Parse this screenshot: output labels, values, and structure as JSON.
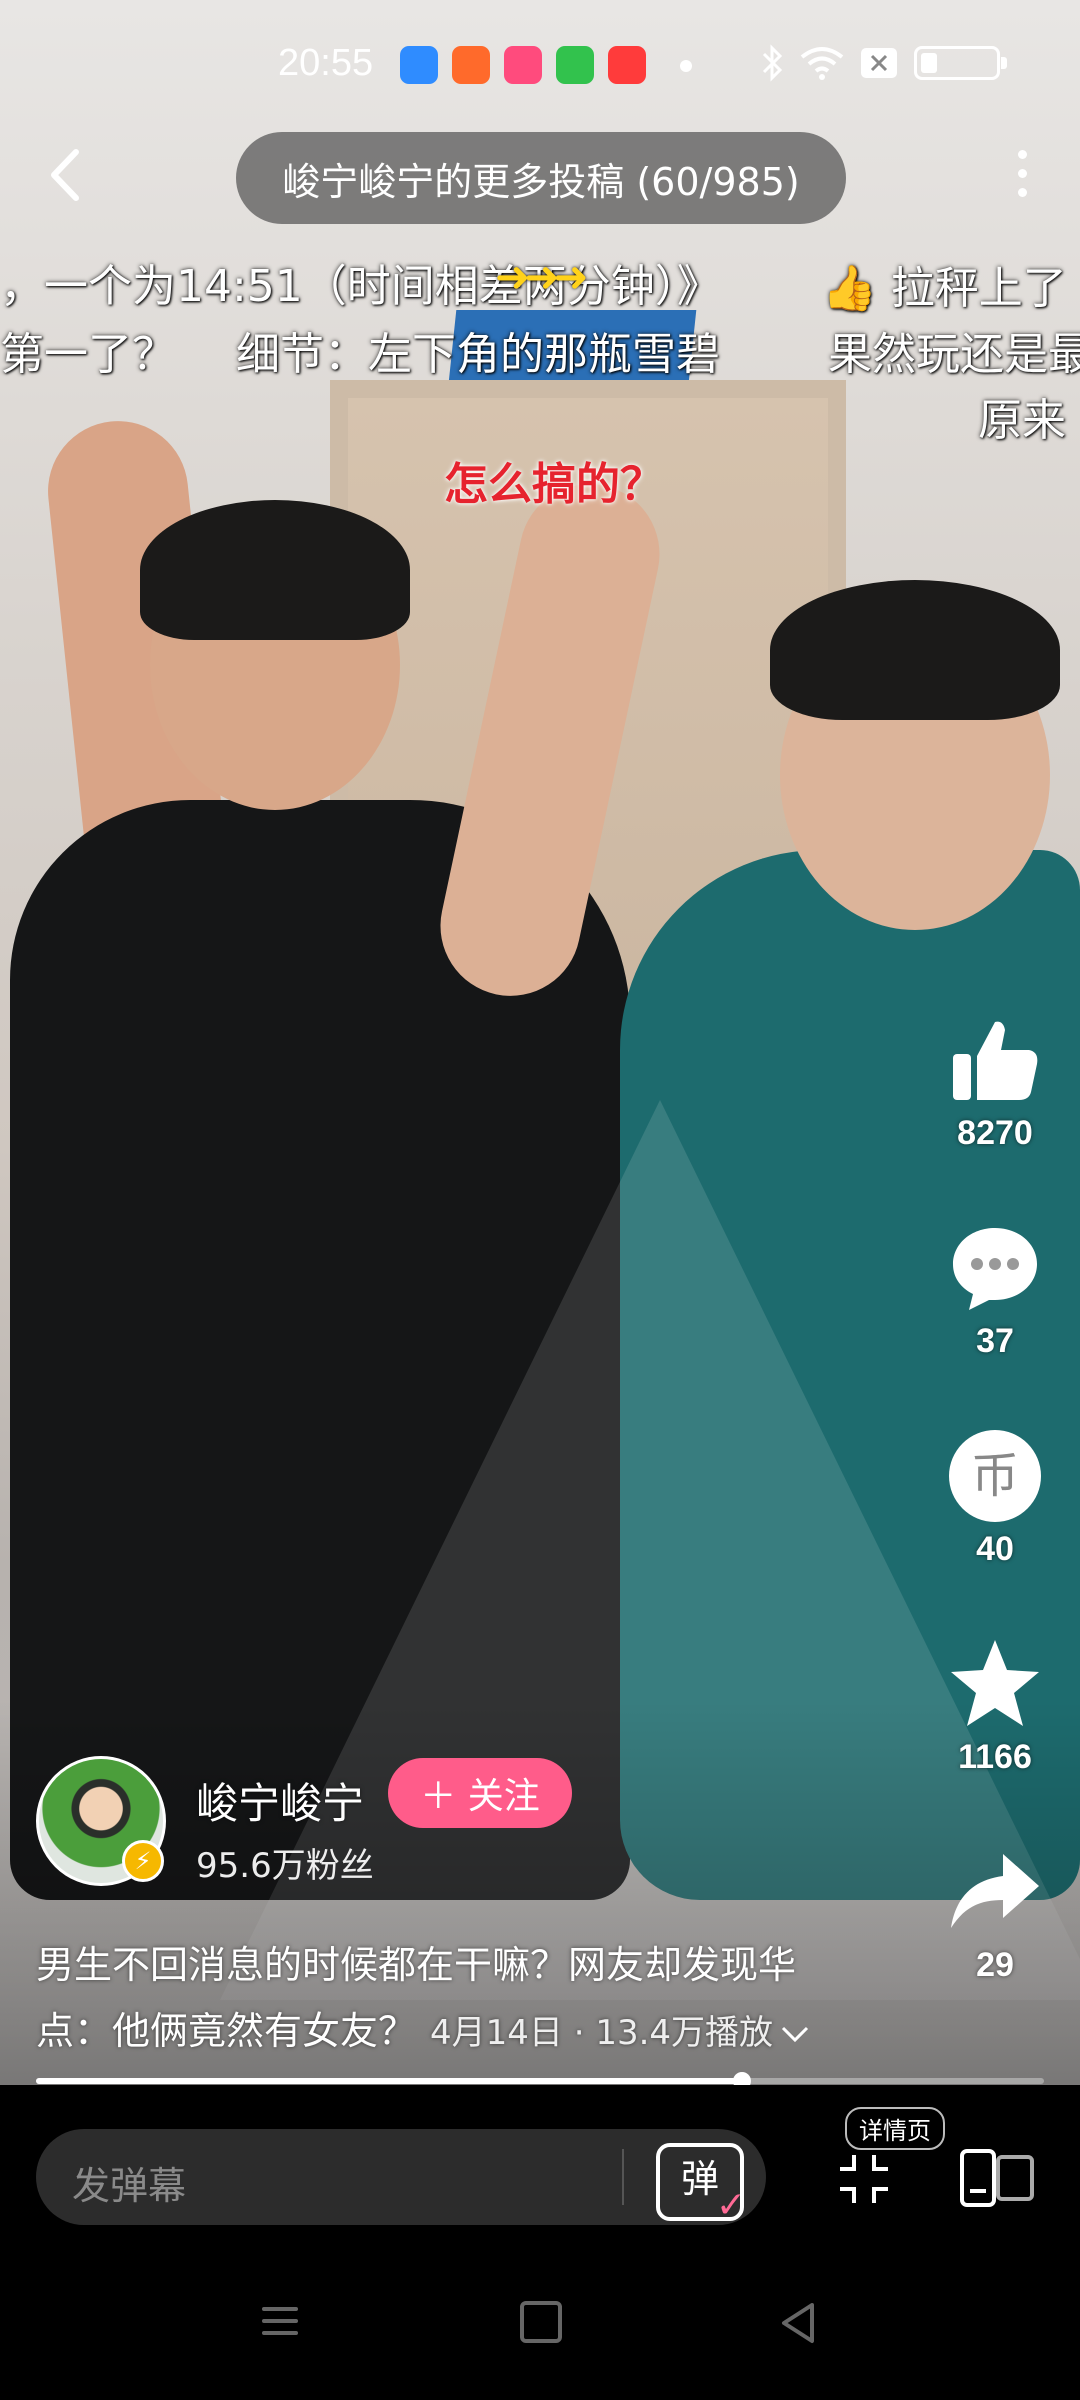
{
  "status_bar": {
    "time": "20:55",
    "app_icons": [
      {
        "icon": "qq-browser-icon",
        "color": "#2f8cff"
      },
      {
        "icon": "video-app-icon",
        "color": "#ff6a2b"
      },
      {
        "icon": "bilibili-icon",
        "color": "#ff4b7d"
      },
      {
        "icon": "android-app-icon",
        "color": "#32c24d"
      },
      {
        "icon": "music-app-icon",
        "color": "#ff3b3b"
      }
    ]
  },
  "header": {
    "title": "峻宁峻宁的更多投稿 (60/985)"
  },
  "danmaku": [
    "，一个为14:51（时间相差两分钟）》",
    "拉秤上了",
    "第一了？",
    "细节：左下角的那瓶雪碧",
    "果然玩还是最",
    "原来",
    "怎么搞的？"
  ],
  "actions": {
    "like_count": "8270",
    "comment_count": "37",
    "coin_count": "40",
    "favorite_count": "1166",
    "share_count": "29",
    "coin_glyph": "币"
  },
  "author": {
    "name": "峻宁峻宁",
    "follow_label": "＋ 关注",
    "fans": "95.6万粉丝"
  },
  "video": {
    "description_line1": "男生不回消息的时候都在干嘛？网友却发现华",
    "description_line2": "点：他俩竟然有女友？",
    "meta": "4月14日 · 13.4万播放",
    "progress": 0.7
  },
  "bottom_bar": {
    "danmaku_placeholder": "发弹幕",
    "danmaku_toggle": "弹",
    "detail_label": "详情页"
  },
  "colors": {
    "follow_button": "#ff5c8a",
    "danmaku_red": "#e6232e"
  }
}
